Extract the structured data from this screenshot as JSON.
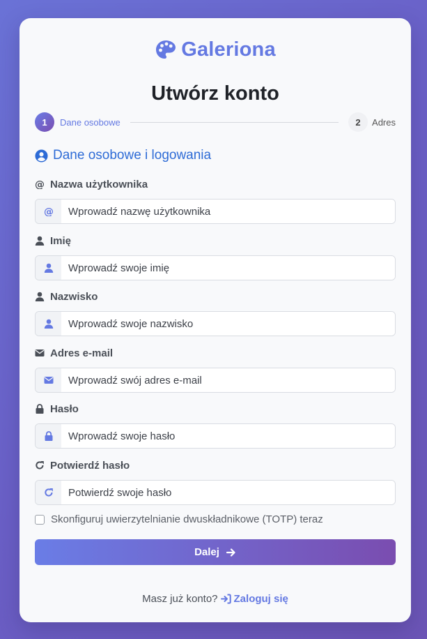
{
  "brand": {
    "name": "Galeriona",
    "icon": "palette-icon",
    "color": "#6479e2"
  },
  "page_title": "Utwórz konto",
  "steps": [
    {
      "number": "1",
      "label": "Dane osobowe",
      "active": true
    },
    {
      "number": "2",
      "label": "Adres",
      "active": false
    }
  ],
  "section": {
    "title": "Dane osobowe i logowania",
    "icon": "user-circle-icon"
  },
  "fields": {
    "username": {
      "label": "Nazwa użytkownika",
      "placeholder": "Wprowadź nazwę użytkownika",
      "icon": "at-icon"
    },
    "first_name": {
      "label": "Imię",
      "placeholder": "Wprowadź swoje imię",
      "icon": "user-icon"
    },
    "last_name": {
      "label": "Nazwisko",
      "placeholder": "Wprowadź swoje nazwisko",
      "icon": "user-icon"
    },
    "email": {
      "label": "Adres e-mail",
      "placeholder": "Wprowadź swój adres e-mail",
      "icon": "envelope-icon"
    },
    "password": {
      "label": "Hasło",
      "placeholder": "Wprowadź swoje hasło",
      "icon": "lock-icon"
    },
    "confirm_password": {
      "label": "Potwierdź hasło",
      "placeholder": "Potwierdź swoje hasło",
      "icon": "redo-icon"
    }
  },
  "totp_checkbox": {
    "label": "Skonfiguruj uwierzytelnianie dwuskładnikowe (TOTP) teraz",
    "checked": false
  },
  "next_button": {
    "label": "Dalej",
    "icon": "arrow-right-icon"
  },
  "login_prompt": {
    "text": "Masz już konto?",
    "link_label": "Zaloguj się",
    "icon": "sign-in-icon"
  },
  "colors": {
    "accent": "#6479e2",
    "section": "#2d6bd6",
    "gradient_start": "#6a7de6",
    "gradient_end": "#7a4db0"
  }
}
